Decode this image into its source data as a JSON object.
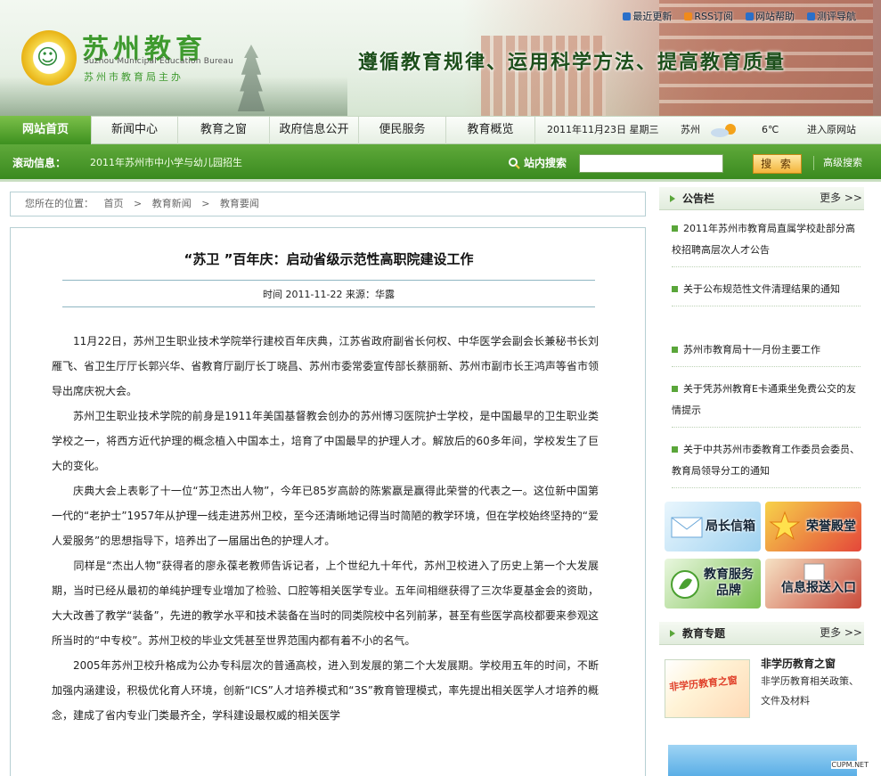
{
  "header": {
    "logo_char": "☺",
    "site_title": "苏州教育",
    "site_en": "Suzhou Municipal Education Bureau",
    "site_sub": "苏州市教育局主办",
    "slogan": "遵循教育规律、运用科学方法、提高教育质量",
    "top_links": [
      {
        "label": "最近更新",
        "icon": "update-icon",
        "color": "#2a6fc9"
      },
      {
        "label": "RSS订阅",
        "icon": "rss-icon",
        "color": "#f08a1c"
      },
      {
        "label": "网站帮助",
        "icon": "help-icon",
        "color": "#2a6fc9"
      },
      {
        "label": "测评导航",
        "icon": "nav-icon",
        "color": "#2a6fc9"
      }
    ]
  },
  "nav": {
    "home": "网站首页",
    "items": [
      "新闻中心",
      "教育之窗",
      "政府信息公开",
      "便民服务",
      "教育概览"
    ],
    "date": "2011年11月23日  星期三",
    "city": "苏州",
    "weather_icon": "partly-cloudy-icon",
    "temp": "6℃",
    "original_site": "进入原网站"
  },
  "bar": {
    "scroll_label": "滚动信息：",
    "scroll_text": "2011年苏州市中小学与幼儿园招生",
    "search_label": "站内搜索",
    "search_value": "",
    "search_button": "搜 索",
    "advanced": "高级搜索"
  },
  "breadcrumb": {
    "prefix": "您所在的位置：",
    "items": [
      "首页",
      "教育新闻",
      "教育要闻"
    ],
    "separator": ">"
  },
  "article": {
    "title": "“苏卫 ”百年庆：启动省级示范性高职院建设工作",
    "meta": "时间  2011-11-22  来源：华露",
    "paragraphs": [
      "11月22日，苏州卫生职业技术学院举行建校百年庆典，江苏省政府副省长何权、中华医学会副会长兼秘书长刘雁飞、省卫生厅厅长郭兴华、省教育厅副厅长丁晓昌、苏州市委常委宣传部长蔡丽新、苏州市副市长王鸿声等省市领导出席庆祝大会。",
      "苏州卫生职业技术学院的前身是1911年美国基督教会创办的苏州博习医院护士学校，是中国最早的卫生职业类学校之一，将西方近代护理的概念植入中国本土，培育了中国最早的护理人才。解放后的60多年间，学校发生了巨大的变化。",
      "庆典大会上表彰了十一位“苏卫杰出人物”，今年已85岁高龄的陈紫嬴是赢得此荣誉的代表之一。这位新中国第一代的“老护士”1957年从护理一线走进苏州卫校，至今还清晰地记得当时简陋的教学环境，但在学校始终坚持的“爱人爱服务”的思想指导下，培养出了一届届出色的护理人才。",
      "      同样是“杰出人物”获得者的廖永葆老教师告诉记者，上个世纪九十年代，苏州卫校进入了历史上第一个大发展期，当时已经从最初的单纯护理专业增加了检验、口腔等相关医学专业。五年间相继获得了三次华夏基金会的资助，大大改善了教学“装备”，先进的教学水平和技术装备在当时的同类院校中名列前茅，甚至有些医学高校都要来参观这所当时的“中专校”。苏州卫校的毕业文凭甚至世界范围内都有着不小的名气。",
      "2005年苏州卫校升格成为公办专科层次的普通高校，进入到发展的第二个大发展期。学校用五年的时间，不断加强内涵建设，积极优化育人环境，创新“ICS”人才培养模式和“3S”教育管理模式，率先提出相关医学人才培养的概念，建成了省内专业门类最齐全，学科建设最权威的相关医学"
    ]
  },
  "sidebar": {
    "notice_title": "公告栏",
    "more": "更多 >>",
    "notices": [
      "2011年苏州市教育局直属学校赴部分高校招聘高层次人才公告",
      "关于公布规范性文件清理结果的通知",
      "苏州市教育局十一月份主要工作",
      "关于凭苏州教育E卡通乘坐免费公交的友情提示",
      "关于中共苏州市委教育工作委员会委员、教育局领导分工的通知"
    ],
    "promos": [
      {
        "label": "局长信箱",
        "color": "#c8e6f6"
      },
      {
        "label": "荣誉殿堂",
        "color": "#e4473a"
      },
      {
        "label": "教育服务品牌",
        "color": "#7cc152"
      },
      {
        "label": "信息报送入口",
        "color": "#c84a3a"
      }
    ],
    "topic_title": "教育专题",
    "topic_image_text": "非学历教育之窗",
    "topic_item_title": "非学历教育之窗",
    "topic_item_desc": "非学历教育相关政策、文件及材料"
  },
  "watermark": "CUPM.NET",
  "colors": {
    "primary_green": "#3b8f1e",
    "accent_green": "#5aa63a",
    "border_blue": "#b6cfd3"
  }
}
